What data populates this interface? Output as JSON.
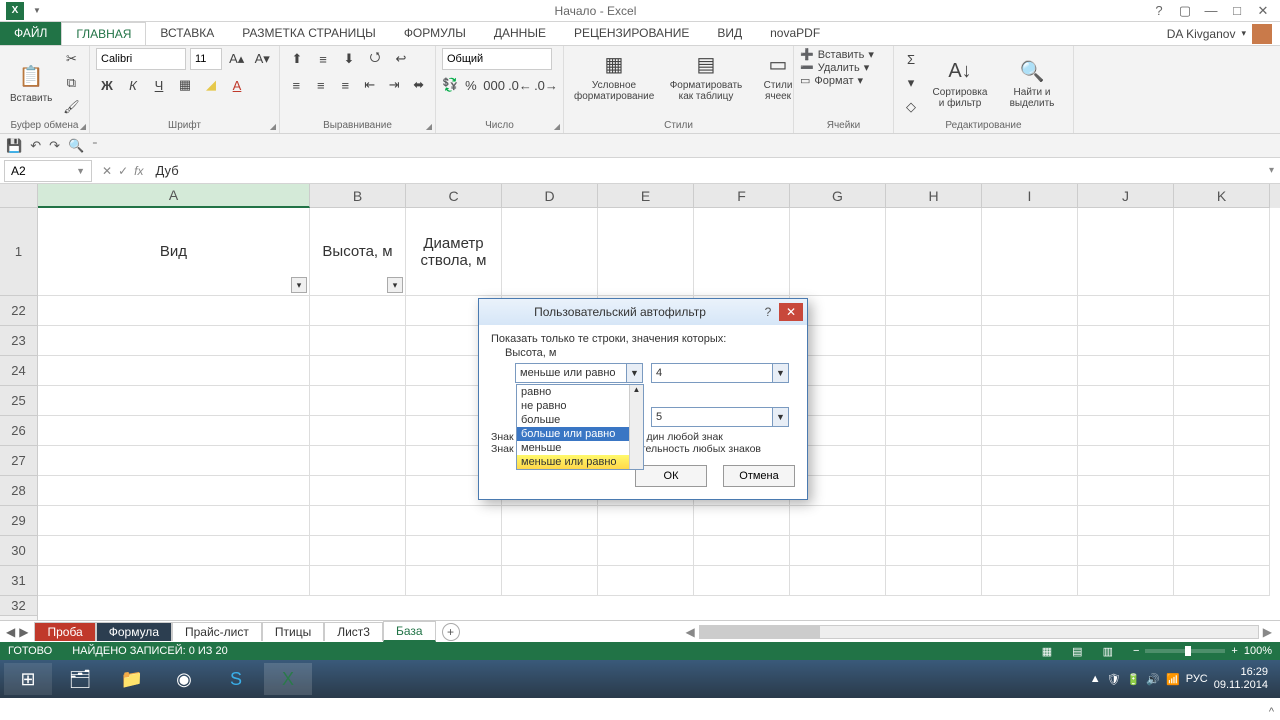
{
  "titlebar": {
    "title": "Начало - Excel"
  },
  "tabs": {
    "file": "ФАЙЛ",
    "items": [
      "ГЛАВНАЯ",
      "ВСТАВКА",
      "РАЗМЕТКА СТРАНИЦЫ",
      "ФОРМУЛЫ",
      "ДАННЫЕ",
      "РЕЦЕНЗИРОВАНИЕ",
      "ВИД",
      "novaPDF"
    ],
    "user": "DA Kivganov"
  },
  "ribbon": {
    "clipboard": {
      "paste": "Вставить",
      "label": "Буфер обмена"
    },
    "font": {
      "name": "Calibri",
      "size": "11",
      "label": "Шрифт"
    },
    "align": {
      "label": "Выравнивание"
    },
    "number": {
      "format": "Общий",
      "label": "Число"
    },
    "styles": {
      "cond": "Условное форматирование",
      "table": "Форматировать как таблицу",
      "cell": "Стили ячеек",
      "label": "Стили"
    },
    "cells": {
      "insert": "Вставить",
      "delete": "Удалить",
      "format": "Формат",
      "label": "Ячейки"
    },
    "editing": {
      "sort": "Сортировка и фильтр",
      "find": "Найти и выделить",
      "label": "Редактирование"
    }
  },
  "namebox": "A2",
  "formula": "Дуб",
  "columns": [
    "A",
    "B",
    "C",
    "D",
    "E",
    "F",
    "G",
    "H",
    "I",
    "J",
    "K"
  ],
  "headers": {
    "A": "Вид",
    "B": "Высота, м",
    "C": "Диаметр ствола, м"
  },
  "visible_rows": [
    "1",
    "22",
    "23",
    "24",
    "25",
    "26",
    "27",
    "28",
    "29",
    "30",
    "31",
    "32"
  ],
  "dialog": {
    "title": "Пользовательский автофильтр",
    "subtitle": "Показать только те строки, значения которых:",
    "field": "Высота, м",
    "op1": "меньше или равно",
    "val1": "4",
    "val2": "5",
    "options": [
      "равно",
      "не равно",
      "больше",
      "больше или равно",
      "меньше",
      "меньше или равно"
    ],
    "highlighted_index": 3,
    "hint1_prefix": "Знак",
    "hint1_suffix": "дин любой знак",
    "hint2": "Знак \"*\" обозначает последовательность любых знаков",
    "ok": "ОК",
    "cancel": "Отмена"
  },
  "sheets": {
    "nav": [
      "◀",
      "▶"
    ],
    "tabs": [
      "Проба",
      "Формула",
      "Прайс-лист",
      "Птицы",
      "Лист3",
      "База"
    ],
    "active": 5
  },
  "status": {
    "ready": "ГОТОВО",
    "found": "НАЙДЕНО ЗАПИСЕЙ: 0 ИЗ 20",
    "zoom": "100%"
  },
  "taskbar": {
    "lang": "РУС",
    "time": "16:29",
    "date": "09.11.2014"
  }
}
